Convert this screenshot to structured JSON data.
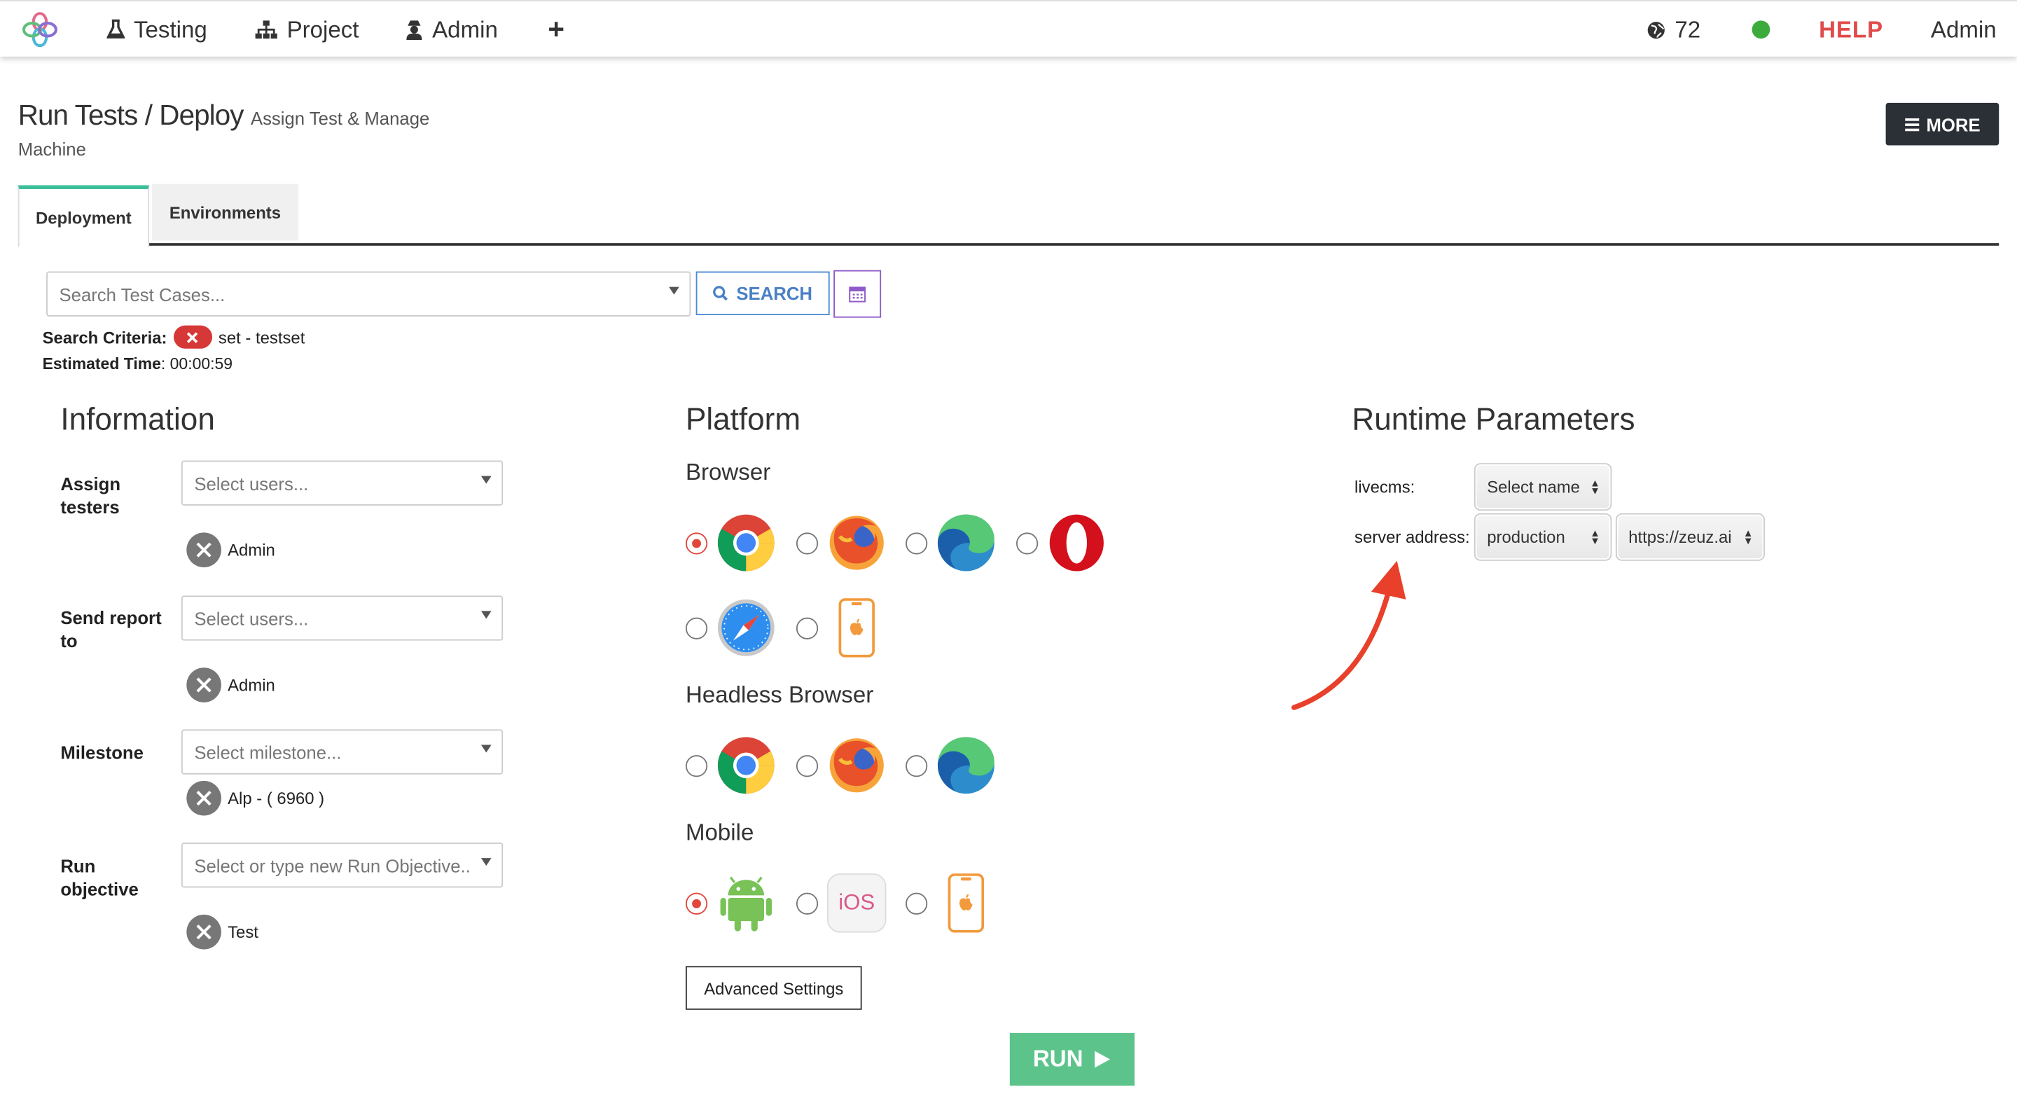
{
  "nav": {
    "testing": "Testing",
    "project": "Project",
    "admin": "Admin",
    "add": "+",
    "notifications_count": "72",
    "help": "HELP",
    "user": "Admin",
    "status_color": "#3cab3c"
  },
  "header": {
    "title": "Run Tests / Deploy",
    "subtitle": "Assign Test & Manage",
    "subtitle_cont": "Machine",
    "more_label": "MORE"
  },
  "tabs": [
    {
      "label": "Deployment",
      "active": true
    },
    {
      "label": "Environments",
      "active": false
    }
  ],
  "search": {
    "placeholder": "Search Test Cases...",
    "search_label": "SEARCH",
    "criteria_label": "Search Criteria:",
    "criteria_value": "set - testset",
    "est_label": "Estimated Time",
    "est_value": ": 00:00:59"
  },
  "information": {
    "heading": "Information",
    "assign_label": "Assign testers",
    "assign_placeholder": "Select users...",
    "assign_chip": "Admin",
    "report_label": "Send report to",
    "report_placeholder": "Select users...",
    "report_chip": "Admin",
    "milestone_label": "Milestone",
    "milestone_placeholder": "Select milestone...",
    "milestone_chip": "Alp - ( 6960 )",
    "objective_label": "Run objective",
    "objective_placeholder": "Select or type new Run Objective..",
    "objective_chip": "Test"
  },
  "platform": {
    "heading": "Platform",
    "browser_label": "Browser",
    "headless_label": "Headless Browser",
    "mobile_label": "Mobile",
    "browsers": [
      "chrome-icon",
      "firefox-icon",
      "edge-icon",
      "opera-icon",
      "safari-icon",
      "ios-device-icon"
    ],
    "selected_browser": "chrome-icon",
    "headless": [
      "chrome-icon",
      "firefox-icon",
      "edge-icon"
    ],
    "mobile": [
      "android-icon",
      "ios-icon",
      "ios-device-icon"
    ],
    "selected_mobile": "android-icon",
    "ios_text": "iOS",
    "advanced_label": "Advanced Settings",
    "run_label": "RUN"
  },
  "runtime": {
    "heading": "Runtime Parameters",
    "livecms_label": "livecms:",
    "livecms_value": "Select name",
    "server_label": "server address:",
    "server_env": "production",
    "server_url": "https://zeuz.ai"
  }
}
